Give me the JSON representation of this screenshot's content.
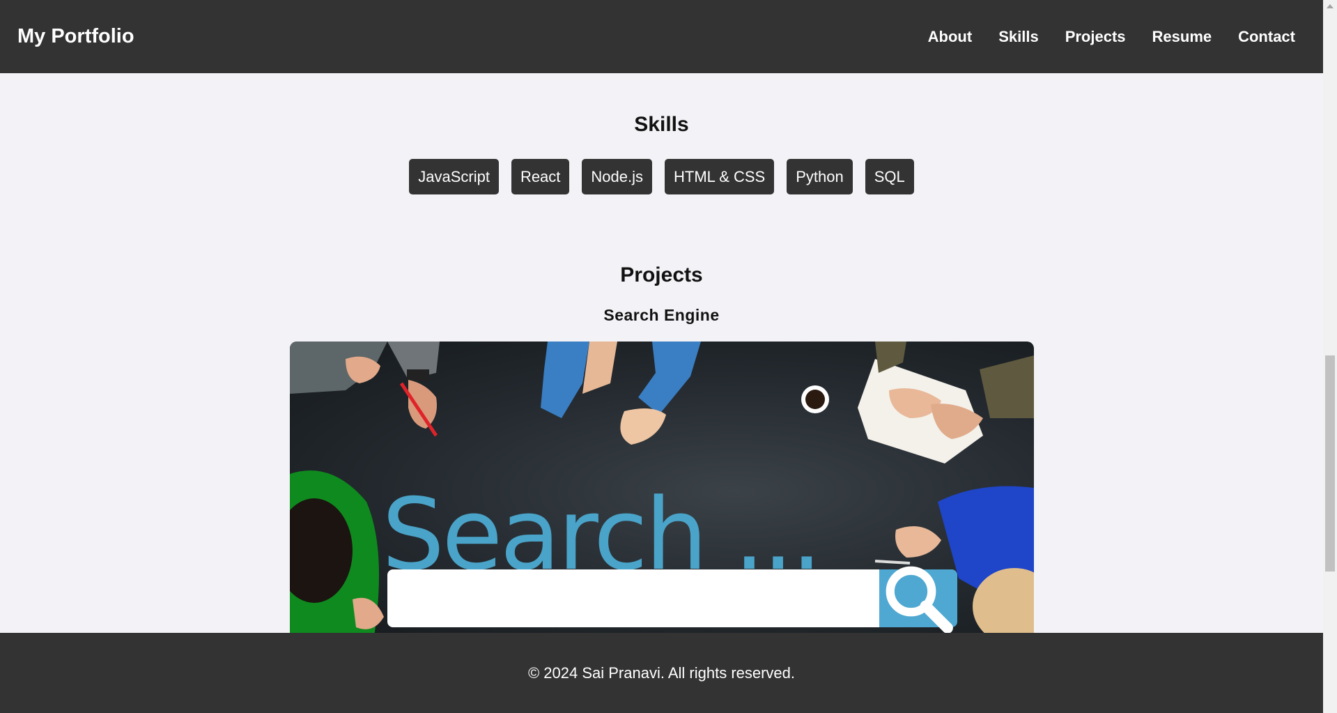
{
  "header": {
    "brand": "My Portfolio",
    "nav": [
      "About",
      "Skills",
      "Projects",
      "Resume",
      "Contact"
    ]
  },
  "skills": {
    "title": "Skills",
    "items": [
      "JavaScript",
      "React",
      "Node.js",
      "HTML & CSS",
      "Python",
      "SQL"
    ]
  },
  "projects": {
    "title": "Projects",
    "items": [
      {
        "name": "Search Engine",
        "image_text": "Search ..."
      }
    ]
  },
  "footer": {
    "text": "© 2024 Sai Pranavi. All rights reserved."
  },
  "colors": {
    "header_bg": "#333333",
    "page_bg": "#f3f3f7",
    "skill_bg": "#333333",
    "accent_blue": "#4aa3c9"
  },
  "icons": {
    "search_button": "magnifier-icon"
  }
}
